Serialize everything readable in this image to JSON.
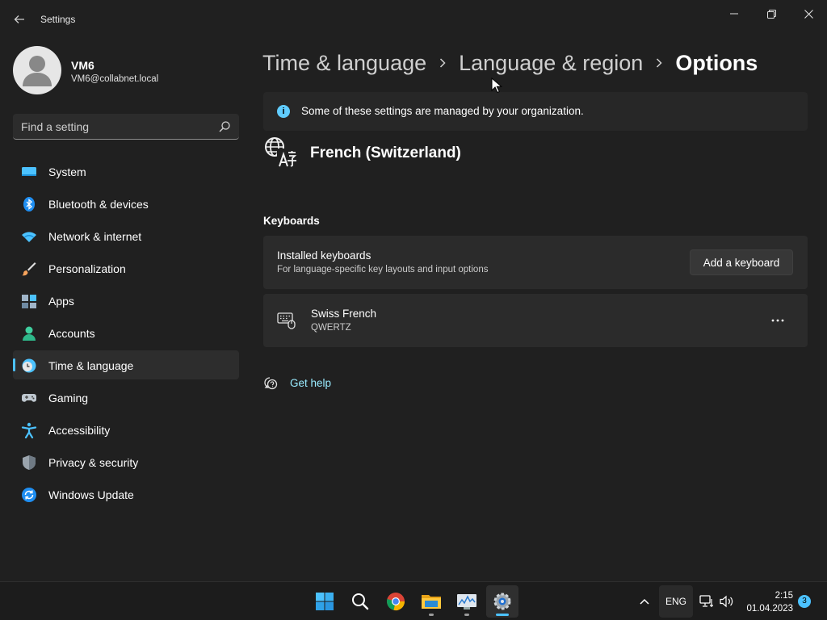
{
  "window": {
    "title": "Settings"
  },
  "profile": {
    "name": "VM6",
    "email": "VM6@collabnet.local"
  },
  "search": {
    "placeholder": "Find a setting",
    "value": ""
  },
  "sidebar": {
    "items": [
      {
        "label": "System",
        "icon": "system-icon"
      },
      {
        "label": "Bluetooth & devices",
        "icon": "bluetooth-icon"
      },
      {
        "label": "Network & internet",
        "icon": "wifi-icon"
      },
      {
        "label": "Personalization",
        "icon": "brush-icon"
      },
      {
        "label": "Apps",
        "icon": "apps-icon"
      },
      {
        "label": "Accounts",
        "icon": "accounts-icon"
      },
      {
        "label": "Time & language",
        "icon": "time-language-icon",
        "selected": true
      },
      {
        "label": "Gaming",
        "icon": "gamepad-icon"
      },
      {
        "label": "Accessibility",
        "icon": "accessibility-icon"
      },
      {
        "label": "Privacy & security",
        "icon": "shield-icon"
      },
      {
        "label": "Windows Update",
        "icon": "update-icon"
      }
    ]
  },
  "breadcrumb": {
    "items": [
      "Time & language",
      "Language & region",
      "Options"
    ]
  },
  "info": {
    "text": "Some of these settings are managed by your organization."
  },
  "language": {
    "title": "French (Switzerland)"
  },
  "keyboards": {
    "header": "Keyboards",
    "installed": {
      "title": "Installed keyboards",
      "subtitle": "For language-specific key layouts and input options",
      "button": "Add a keyboard"
    },
    "items": [
      {
        "name": "Swiss French",
        "layout": "QWERTZ"
      }
    ]
  },
  "help": {
    "label": "Get help"
  },
  "taskbar": {
    "lang": "ENG",
    "time": "2:15",
    "date": "01.04.2023",
    "notifications": "3"
  },
  "colors": {
    "accent": "#4cc2ff",
    "background": "#202020",
    "card": "#2b2b2b",
    "link": "#99ebff"
  }
}
